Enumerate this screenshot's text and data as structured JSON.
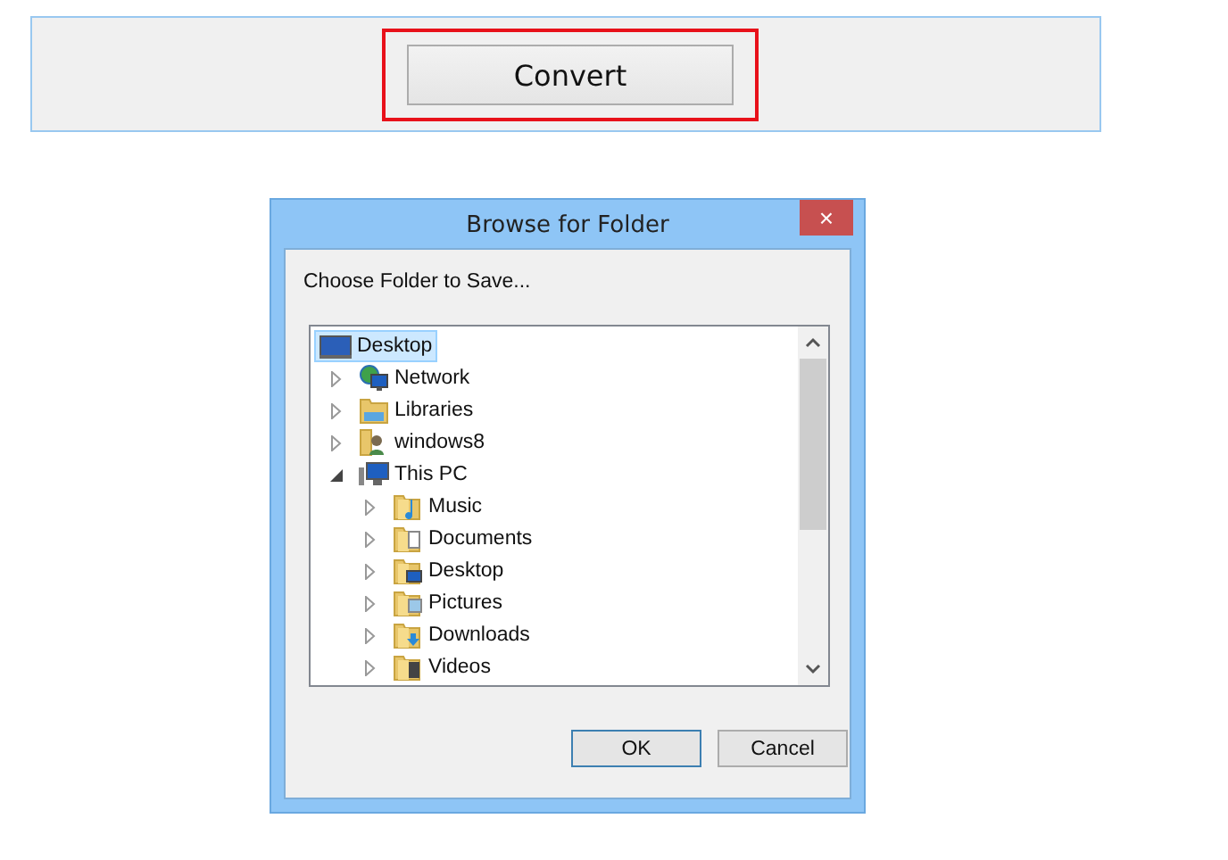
{
  "convert_button": {
    "label": "Convert",
    "highlighted": true
  },
  "dialog": {
    "title": "Browse for Folder",
    "close": "×",
    "prompt": "Choose Folder to Save...",
    "tree": [
      {
        "label": "Desktop",
        "kind": "desktop",
        "selected": true,
        "children": [
          {
            "label": "Network",
            "kind": "network",
            "selected": false,
            "expanded": false
          },
          {
            "label": "Libraries",
            "kind": "library",
            "selected": false,
            "expanded": false
          },
          {
            "label": "windows8",
            "kind": "user",
            "selected": false,
            "expanded": false
          },
          {
            "label": "This PC",
            "kind": "computer",
            "selected": false,
            "expanded": true,
            "children": [
              {
                "label": "Music",
                "kind": "music",
                "selected": false,
                "expanded": false
              },
              {
                "label": "Documents",
                "kind": "documents",
                "selected": false,
                "expanded": false
              },
              {
                "label": "Desktop",
                "kind": "desktopfolder",
                "selected": false,
                "expanded": false
              },
              {
                "label": "Pictures",
                "kind": "pictures",
                "selected": false,
                "expanded": false
              },
              {
                "label": "Downloads",
                "kind": "downloads",
                "selected": false,
                "expanded": false
              },
              {
                "label": "Videos",
                "kind": "videos",
                "selected": false,
                "expanded": false
              }
            ]
          }
        ]
      }
    ],
    "buttons": [
      {
        "label": "OK",
        "default": true
      },
      {
        "label": "Cancel",
        "default": false
      }
    ]
  }
}
